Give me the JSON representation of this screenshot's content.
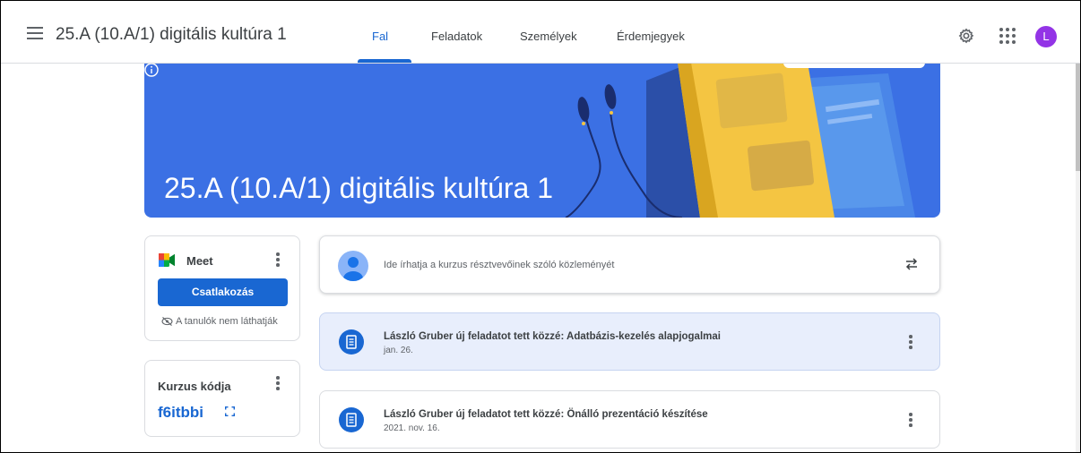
{
  "header": {
    "course_title": "25.A (10.A/1) digitális kultúra 1",
    "tabs": [
      {
        "label": "Fal",
        "active": true
      },
      {
        "label": "Feladatok",
        "active": false
      },
      {
        "label": "Személyek",
        "active": false
      },
      {
        "label": "Érdemjegyek",
        "active": false
      }
    ],
    "icons": [
      "menu-icon",
      "gear-icon",
      "apps-icon"
    ],
    "avatar_initial": "L"
  },
  "banner": {
    "title": "25.A (10.A/1) digitális kultúra 1",
    "icons": [
      "info-icon"
    ]
  },
  "meet": {
    "label": "Meet",
    "join_label": "Csatlakozás",
    "visibility_note": "A tanulók nem láthatják"
  },
  "class_code": {
    "label": "Kurzus kódja",
    "value": "f6itbbi"
  },
  "announcement": {
    "placeholder": "Ide írhatja a kurzus résztvevőinek szóló közleményét"
  },
  "stream": [
    {
      "title": "László Gruber új feladatot tett közzé: Adatbázis-kezelés alapjogalmai",
      "date": "jan. 26."
    },
    {
      "title": "László Gruber új feladatot tett közzé: Önálló prezentáció készítése",
      "date": "2021. nov. 16."
    }
  ],
  "colors": {
    "accent": "#1967d2",
    "banner": "#3b70e4",
    "avatar": "#9334e6",
    "highlight_row": "#e8eefc"
  }
}
